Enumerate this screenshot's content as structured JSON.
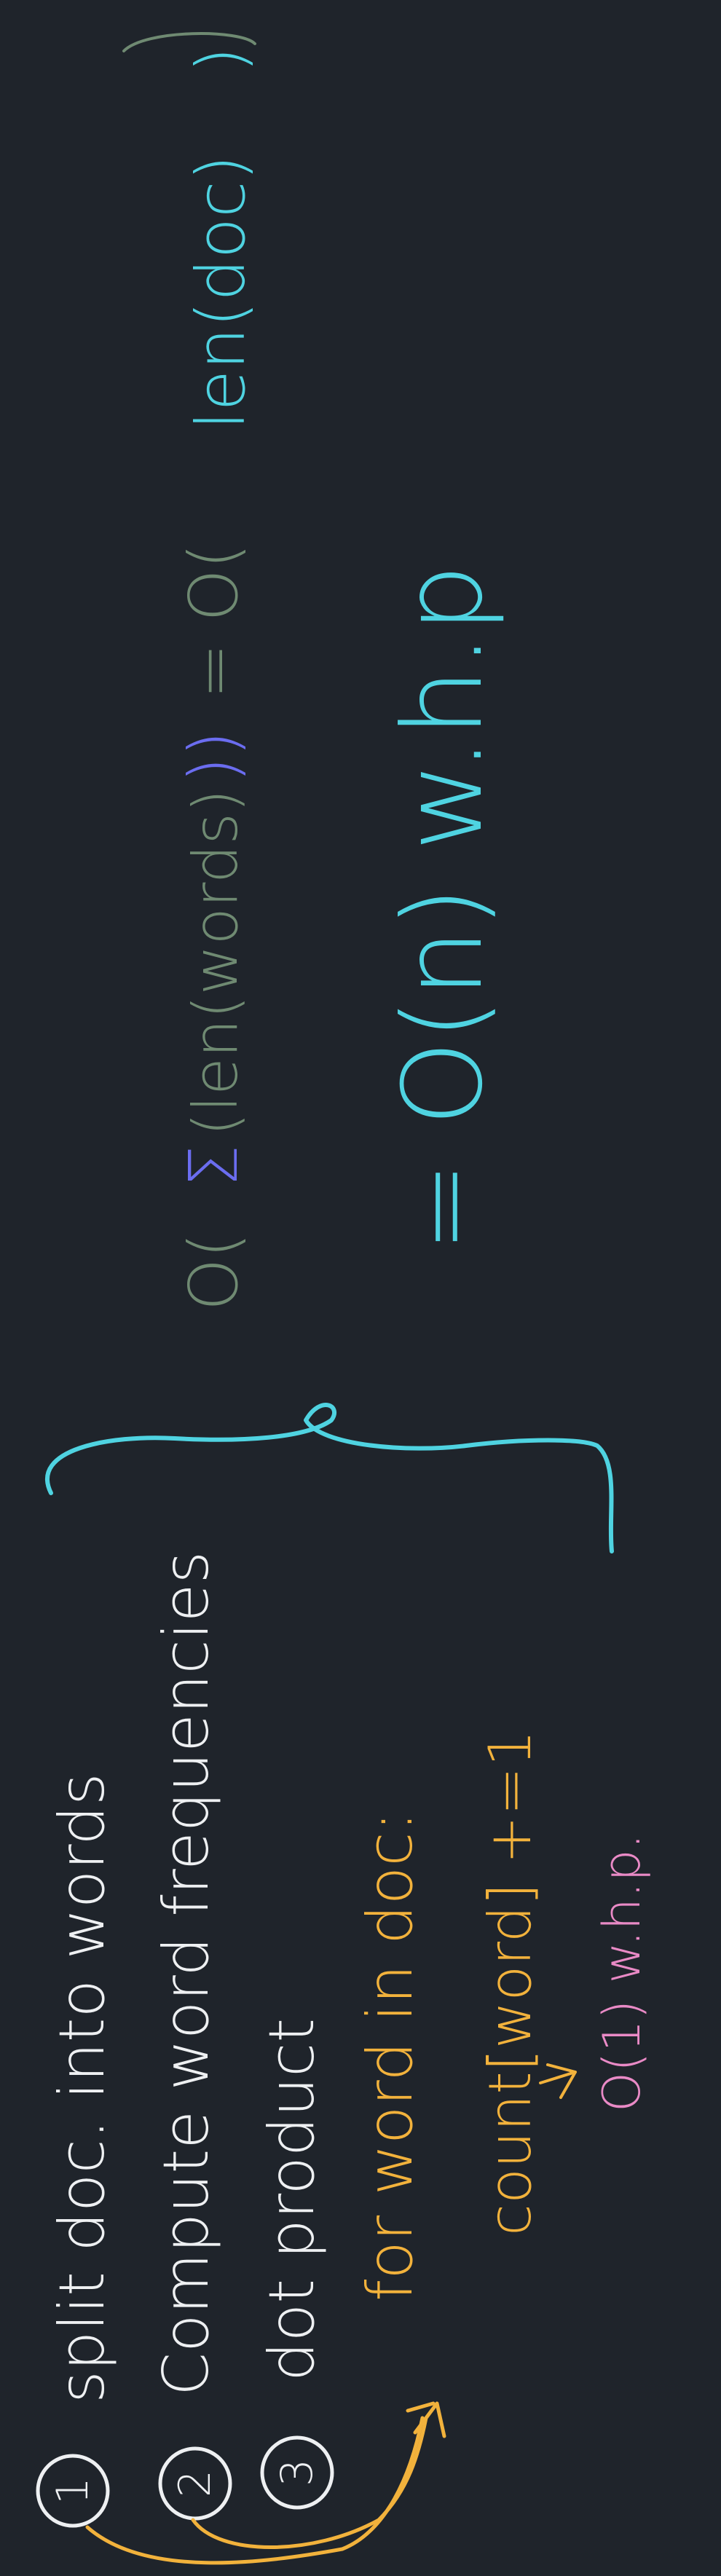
{
  "colors": {
    "background": "#1f242b",
    "white": "#eef0f2",
    "cyan": "#4fd3e1",
    "orange": "#f2b23c",
    "pink": "#e98ac6",
    "gray_green": "#6f8a72",
    "blue": "#6b6df0"
  },
  "steps": [
    {
      "number": "1",
      "text": "split doc. into words"
    },
    {
      "number": "2",
      "text": "Compute word frequencies"
    },
    {
      "number": "3",
      "text": "dot product"
    }
  ],
  "code": {
    "line1": "for word in doc:",
    "line2": "count[word] +=1",
    "cost": "O(1) w.h.p."
  },
  "analysis": {
    "sum_expr_big_o": "O(",
    "sum_expr_sigma": "Σ",
    "sum_expr_len": "(len(words)",
    "sum_expr_close": "))",
    "equals_1": "= O(",
    "len_doc": "len(doc)",
    "close_1": ")",
    "result": "= O(n) w.h.p"
  }
}
